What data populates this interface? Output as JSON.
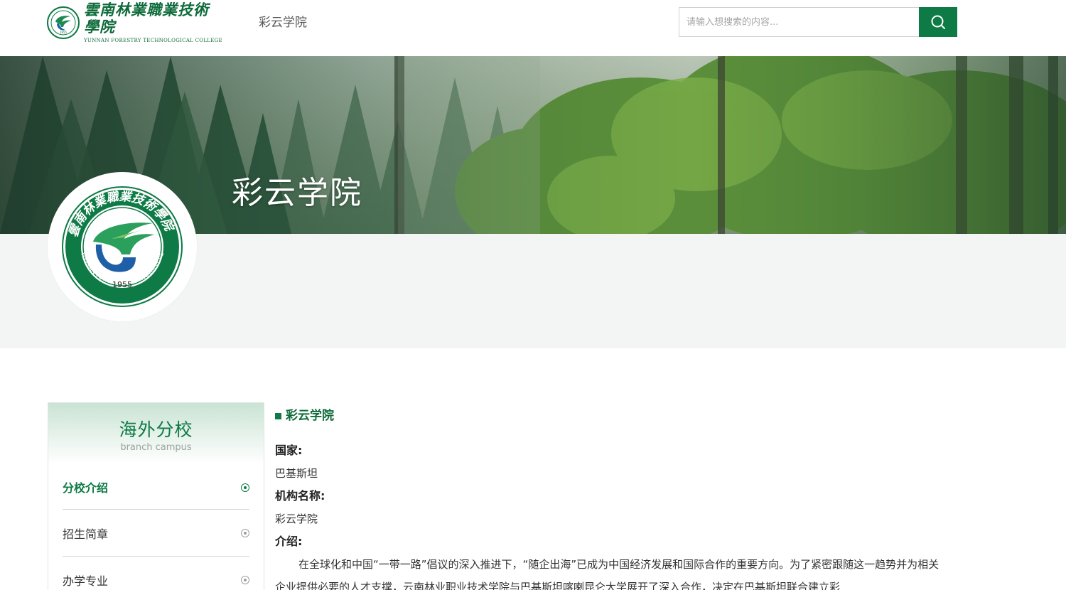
{
  "header": {
    "logo_cn": "雲南林業職業技術學院",
    "logo_en": "YUNNAN FORESTRY TECHNOLOGICAL COLLEGE",
    "nav_label": "彩云学院",
    "search_placeholder": "请输入想搜索的内容..."
  },
  "banner": {
    "title": "彩云学院"
  },
  "emblem": {
    "ring_text": "雲南林業職業技術學院",
    "ring_text_en": "YUNNAN FORESTRY TECHNOLOGICAL COLLEGE",
    "year": "1955"
  },
  "sidebar": {
    "title": "海外分校",
    "subtitle": "branch campus",
    "items": [
      {
        "label": "分校介绍",
        "active": true
      },
      {
        "label": "招生简章",
        "active": false
      },
      {
        "label": "办学专业",
        "active": false
      }
    ]
  },
  "content": {
    "title": "彩云学院",
    "country_label": "国家:",
    "country_value": "巴基斯坦",
    "org_label": "机构名称:",
    "org_value": "彩云学院",
    "intro_label": "介绍:",
    "intro_text": "在全球化和中国“一带一路”倡议的深入推进下，“随企出海”已成为中国经济发展和国际合作的重要方向。为了紧密跟随这一趋势并为相关企业提供必要的人才支撑，云南林业职业技术学院与巴基斯坦喀喇昆仑大学展开了深入合作，决定在巴基斯坦联合建立彩"
  },
  "colors": {
    "brand_green": "#0e7a45",
    "dark_green": "#0e6b3a",
    "band_grey": "#f3f5f4"
  },
  "icons": {
    "search": "search-icon",
    "item_marker": "radio-dot-icon"
  }
}
